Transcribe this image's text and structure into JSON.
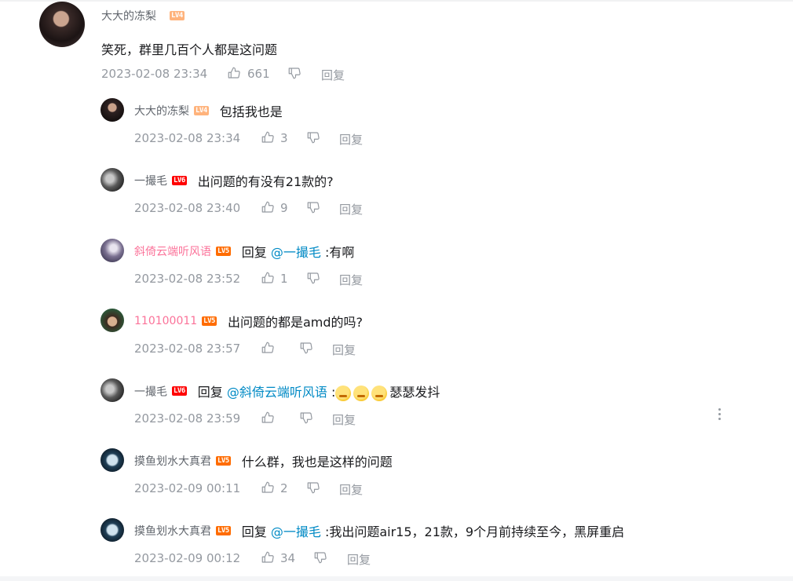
{
  "root_comment": {
    "username": "大大的冻梨",
    "level": "LV4",
    "content": "笑死，群里几百个人都是这问题",
    "time": "2023-02-08 23:34",
    "likes": "661",
    "reply_label": "回复"
  },
  "replies": [
    {
      "username": "大大的冻梨",
      "level": "LV4",
      "prefix": "",
      "at": "",
      "text": "包括我也是",
      "time": "2023-02-08 23:34",
      "likes": "3",
      "reply_label": "回复"
    },
    {
      "username": "一撮毛",
      "level": "LV6",
      "prefix": "",
      "at": "",
      "text": "出问题的有没有21款的?",
      "time": "2023-02-08 23:40",
      "likes": "9",
      "reply_label": "回复"
    },
    {
      "username": "斜倚云端听风语",
      "level": "LV5",
      "prefix": "回复 ",
      "at": "@一撮毛",
      "text": " :有啊",
      "time": "2023-02-08 23:52",
      "likes": "1",
      "reply_label": "回复"
    },
    {
      "username": "110100011",
      "level": "LV5",
      "prefix": "",
      "at": "",
      "text": "出问题的都是amd的吗?",
      "time": "2023-02-08 23:57",
      "likes": "",
      "reply_label": "回复"
    },
    {
      "username": "一撮毛",
      "level": "LV6",
      "prefix": "回复 ",
      "at": "@斜倚云端听风语",
      "text": " :",
      "suffix": "瑟瑟发抖",
      "time": "2023-02-08 23:59",
      "likes": "",
      "reply_label": "回复"
    },
    {
      "username": "摸鱼划水大真君",
      "level": "LV5",
      "prefix": "",
      "at": "",
      "text": "什么群，我也是这样的问题",
      "time": "2023-02-09 00:11",
      "likes": "2",
      "reply_label": "回复"
    },
    {
      "username": "摸鱼划水大真君",
      "level": "LV5",
      "prefix": "回复 ",
      "at": "@一撮毛",
      "text": " :我出问题air15，21款，9个月前持续至今，黑屏重启",
      "time": "2023-02-09 00:12",
      "likes": "34",
      "reply_label": "回复"
    }
  ],
  "icons": {
    "like": "thumbs-up-icon",
    "dislike": "thumbs-down-icon",
    "emoji": "shiver-emoji",
    "more": "more-vertical-icon"
  },
  "colors": {
    "username": "#61666d",
    "username_highlight": "#fb7299",
    "link": "#008ac5",
    "meta": "#9499a0",
    "lv4": "#ffb37c",
    "lv5": "#ff6c00",
    "lv6": "#ff0000"
  }
}
